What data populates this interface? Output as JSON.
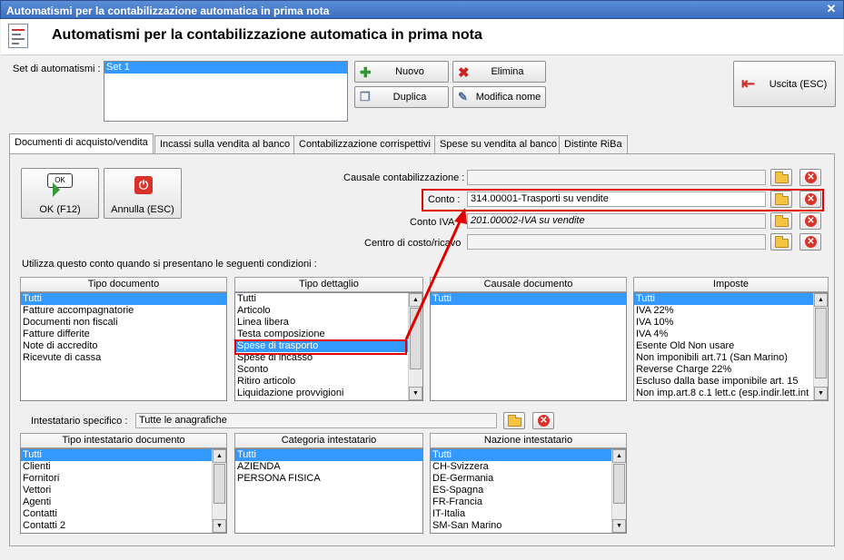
{
  "window": {
    "title": "Automatismi per la contabilizzazione automatica in prima nota",
    "header": "Automatismi per la contabilizzazione automatica in prima nota"
  },
  "sets": {
    "label": "Set di automatismi :",
    "items": [
      "Set 1"
    ]
  },
  "toolbar": {
    "new": "Nuovo",
    "delete": "Elimina",
    "duplicate": "Duplica",
    "rename": "Modifica nome",
    "exit": "Uscita (ESC)"
  },
  "tabs": [
    "Documenti di acquisto/vendita",
    "Incassi sulla vendita al banco",
    "Contabilizzazione corrispettivi",
    "Spese su vendita al banco",
    "Distinte RiBa"
  ],
  "actions": {
    "ok": "OK (F12)",
    "ok_badge": "OK",
    "cancel": "Annulla (ESC)"
  },
  "fields": {
    "causale_label": "Causale contabilizzazione :",
    "causale_value": "",
    "conto_label": "Conto :",
    "conto_value": "314.00001-Trasporti su vendite",
    "conto_iva_label": "Conto IVA :",
    "conto_iva_value": "201.00002-IVA su vendite",
    "centro_label": "Centro di costo/ricavo",
    "centro_value": ""
  },
  "conditions_label": "Utilizza questo conto quando si presentano le seguenti condizioni :",
  "lists": {
    "tipo_documento": {
      "header": "Tipo documento",
      "items": [
        "Tutti",
        "Fatture accompagnatorie",
        "Documenti non fiscali",
        "Fatture differite",
        "Note di accredito",
        "Ricevute di cassa"
      ],
      "selected": 0
    },
    "tipo_dettaglio": {
      "header": "Tipo dettaglio",
      "items": [
        "Tutti",
        "Articolo",
        "Linea libera",
        "Testa composizione",
        "Spese di trasporto",
        "Spese di incasso",
        "Sconto",
        "Ritiro articolo",
        "Liquidazione provvigioni"
      ],
      "selected": 4
    },
    "causale_documento": {
      "header": "Causale documento",
      "items": [
        "Tutti"
      ],
      "selected": 0
    },
    "imposte": {
      "header": "Imposte",
      "items": [
        "Tutti",
        "IVA 22%",
        "IVA 10%",
        "IVA 4%",
        "Esente Old Non usare",
        "Non imponibili art.71 (San Marino)",
        "Reverse Charge 22%",
        "Escluso dalla base imponibile art. 15",
        "Non imp.art.8 c.1 lett.c (esp.indir.lett.int"
      ],
      "selected": 0
    },
    "tipo_intestatario": {
      "header": "Tipo intestatario documento",
      "items": [
        "Tutti",
        "Clienti",
        "Fornitori",
        "Vettori",
        "Agenti",
        "Contatti",
        "Contatti 2"
      ],
      "selected": 0
    },
    "categoria_intestatario": {
      "header": "Categoria intestatario",
      "items": [
        "Tutti",
        "AZIENDA",
        "PERSONA FISICA"
      ],
      "selected": 0
    },
    "nazione_intestatario": {
      "header": "Nazione intestatario",
      "items": [
        "Tutti",
        "CH-Svizzera",
        "DE-Germania",
        "ES-Spagna",
        "FR-Francia",
        "IT-Italia",
        "SM-San Marino"
      ],
      "selected": 0
    }
  },
  "intestatario": {
    "label": "Intestatario specifico :",
    "value": "Tutte le anagrafiche"
  },
  "colors": {
    "selection": "#3399ff",
    "highlight": "#e00000",
    "titlebar": "#3a6fc0"
  }
}
